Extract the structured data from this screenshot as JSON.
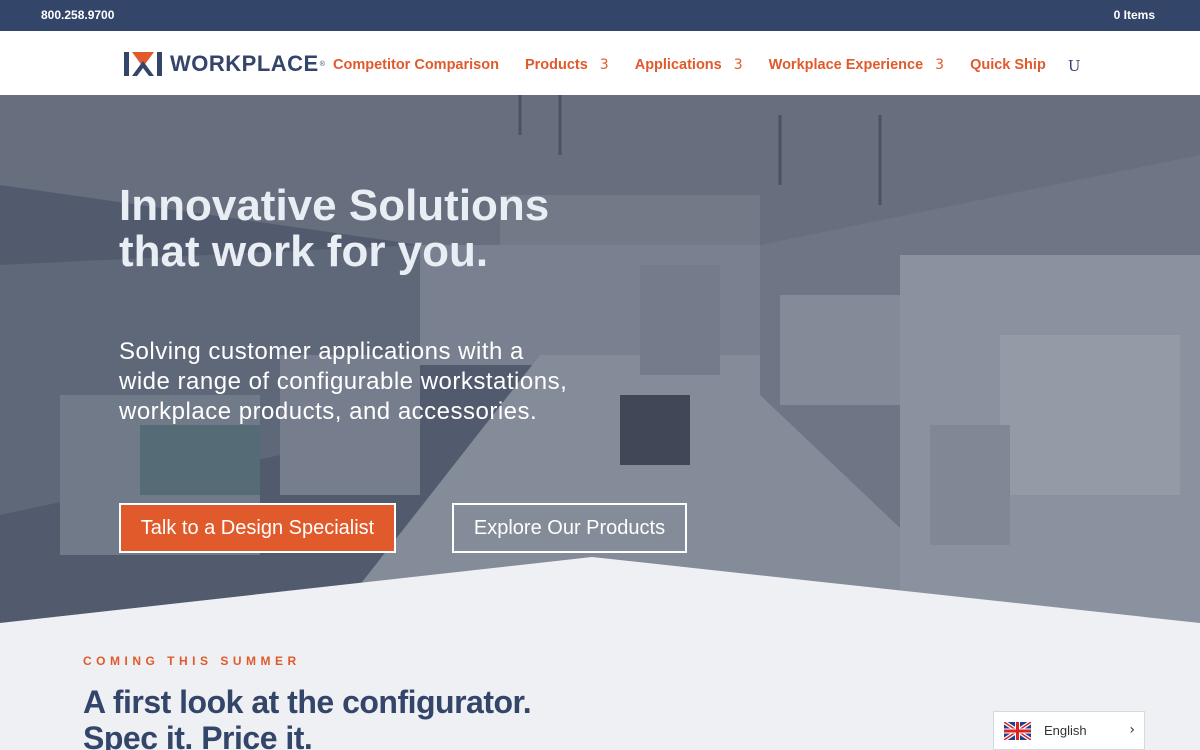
{
  "topbar": {
    "phone": "800.258.9700",
    "cart": "0 Items"
  },
  "brand": {
    "name": "WORKPLACE",
    "reg": "®"
  },
  "nav": {
    "items": [
      {
        "label": "Competitor Comparison",
        "caret": ""
      },
      {
        "label": "Products",
        "caret": "3"
      },
      {
        "label": "Applications",
        "caret": "3"
      },
      {
        "label": "Workplace Experience",
        "caret": "3"
      },
      {
        "label": "Quick Ship",
        "caret": ""
      }
    ],
    "search_glyph": "U",
    "search_icon": "search-icon"
  },
  "hero": {
    "title": "Innovative Solutions that work for you.",
    "subtitle": "Solving customer applications with a wide range of configurable workstations, workplace products, and accessories.",
    "primary_cta": "Talk to a Design Specialist",
    "secondary_cta": "Explore Our Products"
  },
  "section": {
    "eyebrow": "COMING THIS SUMMER",
    "title": "A first look at the configurator. Spec it. Price it."
  },
  "language": {
    "label": "English",
    "flag_icon": "uk-flag-icon",
    "chevron_icon": "chevron-right-icon"
  },
  "colors": {
    "navy": "#34456a",
    "accent": "#e05a2b",
    "light_bg": "#eef0f4"
  }
}
